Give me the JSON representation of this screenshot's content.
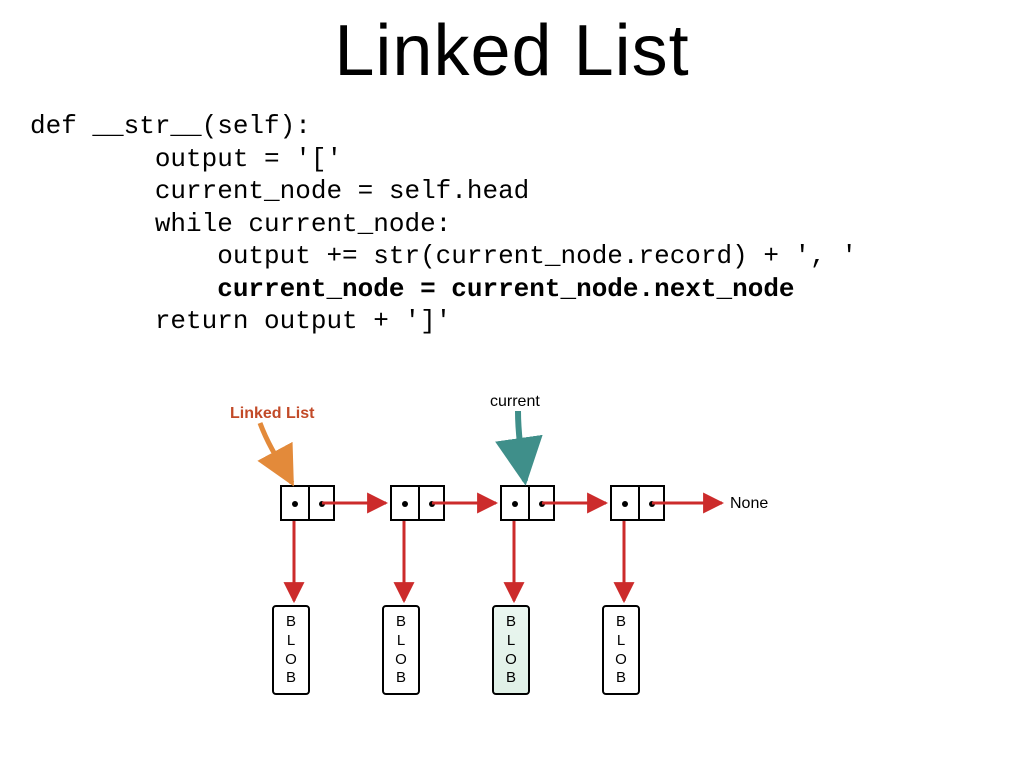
{
  "title": "Linked List",
  "code": {
    "l1": "def __str__(self):",
    "l2": "        output = '['",
    "l3": "        current_node = self.head",
    "l4": "        while current_node:",
    "l5": "            output += str(current_node.record) + ', '",
    "l6_bold": "            current_node = current_node.next_node",
    "l7": "        return output + ']'"
  },
  "diagram": {
    "linked_list_label": "Linked List",
    "current_label": "current",
    "none_label": "None",
    "blob_text": "B\nL\nO\nB"
  }
}
